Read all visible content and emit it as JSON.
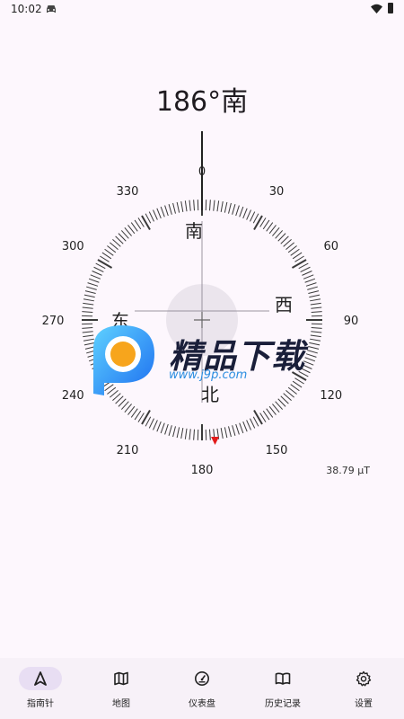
{
  "status_bar": {
    "time": "10:02"
  },
  "heading": "186°南",
  "compass": {
    "bearing_deg": 186,
    "dial_labels": [
      "180",
      "210",
      "240",
      "270",
      "300",
      "330",
      "0",
      "30",
      "60",
      "90",
      "120",
      "150"
    ],
    "cardinals": {
      "south": "南",
      "west": "西",
      "north": "北",
      "east": "东"
    }
  },
  "field_strength": "38.79 μT",
  "watermark": {
    "title": "精品下载",
    "url": "www.j9p.com"
  },
  "nav": [
    {
      "label": "指南针",
      "icon": "navigation-arrow-icon",
      "active": true
    },
    {
      "label": "地图",
      "icon": "map-icon",
      "active": false
    },
    {
      "label": "仪表盘",
      "icon": "speedometer-icon",
      "active": false
    },
    {
      "label": "历史记录",
      "icon": "book-icon",
      "active": false
    },
    {
      "label": "设置",
      "icon": "gear-icon",
      "active": false
    }
  ],
  "colors": {
    "accent": "#e8def3",
    "north_marker": "#e21b1b",
    "background": "#fdf7fd"
  }
}
